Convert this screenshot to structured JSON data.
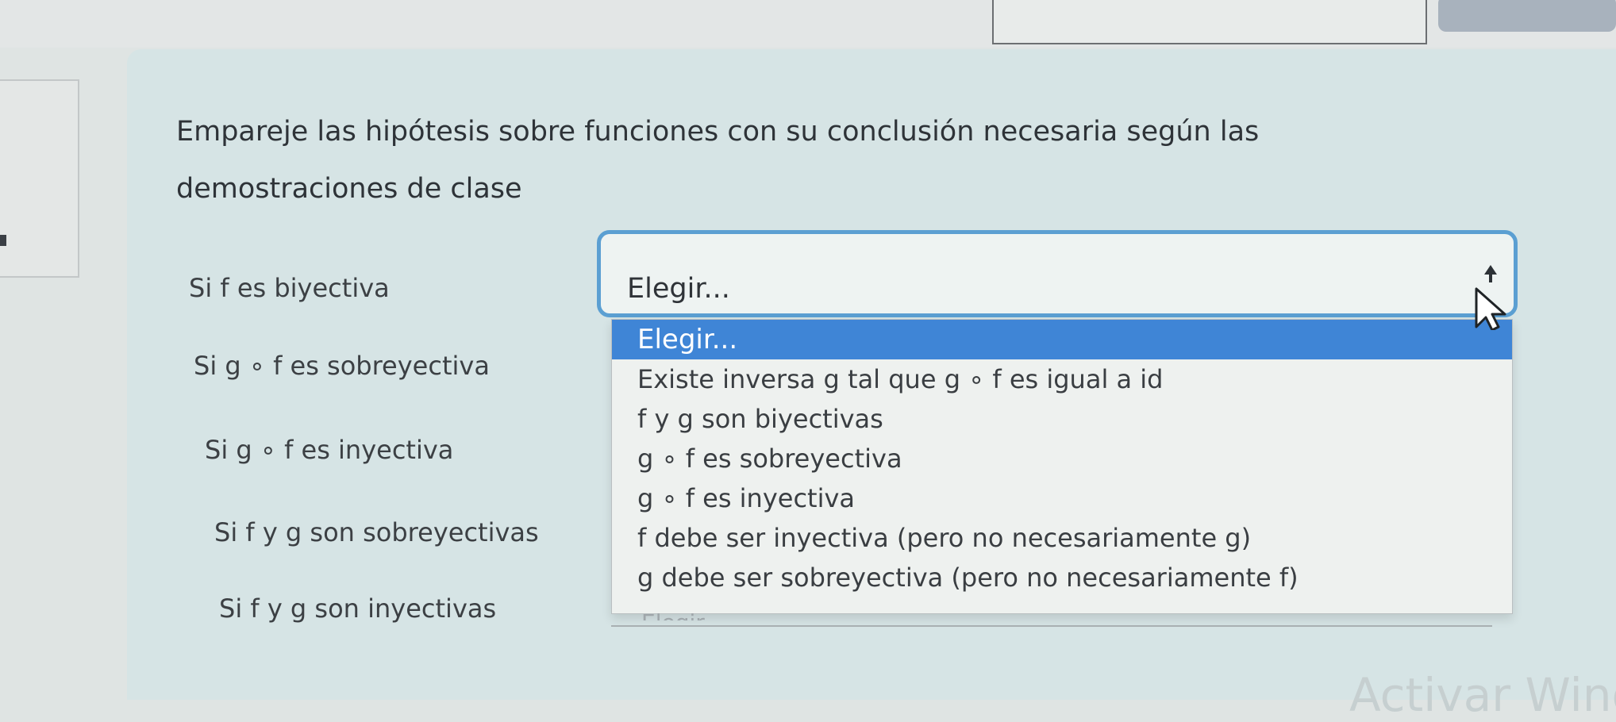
{
  "question": {
    "text": "Empareje las hipótesis sobre funciones con su conclusión necesaria según las demostraciones de clase"
  },
  "rows": [
    {
      "label": "Si f es biyectiva"
    },
    {
      "label": "Si g ∘ f es sobreyectiva"
    },
    {
      "label": "Si g ∘ f es inyectiva"
    },
    {
      "label": "Si f y g son sobreyectivas"
    },
    {
      "label": "Si f y g son inyectivas"
    }
  ],
  "select": {
    "value": "Elegir...",
    "options": [
      {
        "label": "Elegir...",
        "selected": true
      },
      {
        "label": "Existe inversa g tal que g ∘ f es igual a id",
        "selected": false
      },
      {
        "label": "f y g son biyectivas",
        "selected": false
      },
      {
        "label": "g ∘ f es sobreyectiva",
        "selected": false
      },
      {
        "label": "g ∘ f es inyectiva",
        "selected": false
      },
      {
        "label": "f debe ser inyectiva (pero no necesariamente g)",
        "selected": false
      },
      {
        "label": "g debe ser sobreyectiva (pero no necesariamente f)",
        "selected": false
      }
    ],
    "hidden_value": "Elegir..."
  },
  "watermark": {
    "text": "Activar Wind"
  },
  "colors": {
    "accent": "#3f85d6",
    "focus_border": "#5b9fd2"
  },
  "icons": {
    "cursor": "mouse-pointer-icon"
  }
}
